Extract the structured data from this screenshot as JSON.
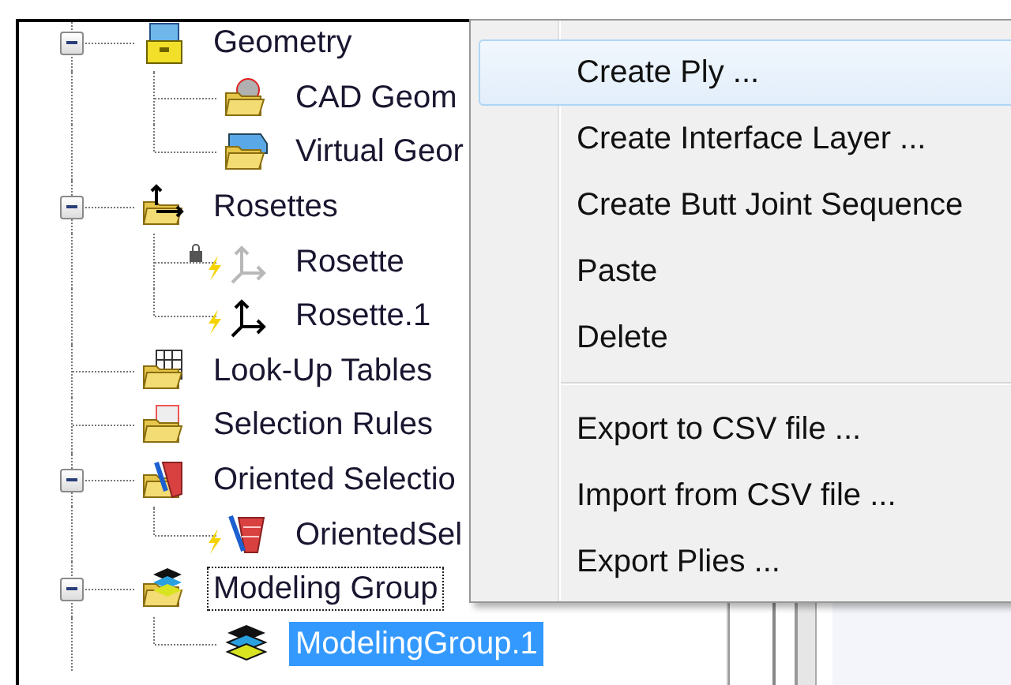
{
  "tree": [
    {
      "label": "Geometry",
      "kind": "geometry",
      "expanded": true,
      "children": [
        {
          "label": "CAD Geom",
          "kind": "cad"
        },
        {
          "label": "Virtual Geor",
          "kind": "virtual"
        }
      ]
    },
    {
      "label": "Rosettes",
      "kind": "rosettes",
      "expanded": true,
      "children": [
        {
          "label": "Rosette",
          "kind": "rosette",
          "locked": true,
          "pending": true
        },
        {
          "label": "Rosette.1",
          "kind": "rosette",
          "locked": false,
          "pending": true
        }
      ]
    },
    {
      "label": "Look-Up Tables",
      "kind": "lookup"
    },
    {
      "label": "Selection Rules",
      "kind": "rules"
    },
    {
      "label": "Oriented Selectio",
      "kind": "oriented",
      "expanded": true,
      "children": [
        {
          "label": "OrientedSel",
          "kind": "oriented-item",
          "pending": true
        }
      ]
    },
    {
      "label": "Modeling Group",
      "kind": "modeling",
      "expanded": true,
      "focused": true,
      "children": [
        {
          "label": "ModelingGroup.1",
          "kind": "layers",
          "selected": true
        }
      ]
    }
  ],
  "context_menu": [
    {
      "kind": "item",
      "label": "Create Ply ...",
      "selected": true
    },
    {
      "kind": "item",
      "label": "Create Interface Layer ...",
      "selected": false
    },
    {
      "kind": "item",
      "label": "Create Butt Joint Sequence",
      "selected": false
    },
    {
      "kind": "item",
      "label": "Paste",
      "selected": false
    },
    {
      "kind": "item",
      "label": "Delete",
      "selected": false
    },
    {
      "kind": "separator"
    },
    {
      "kind": "item",
      "label": "Export to CSV file ...",
      "selected": false
    },
    {
      "kind": "item",
      "label": "Import from CSV file ...",
      "selected": false
    },
    {
      "kind": "item",
      "label": "Export Plies ...",
      "selected": false
    }
  ]
}
